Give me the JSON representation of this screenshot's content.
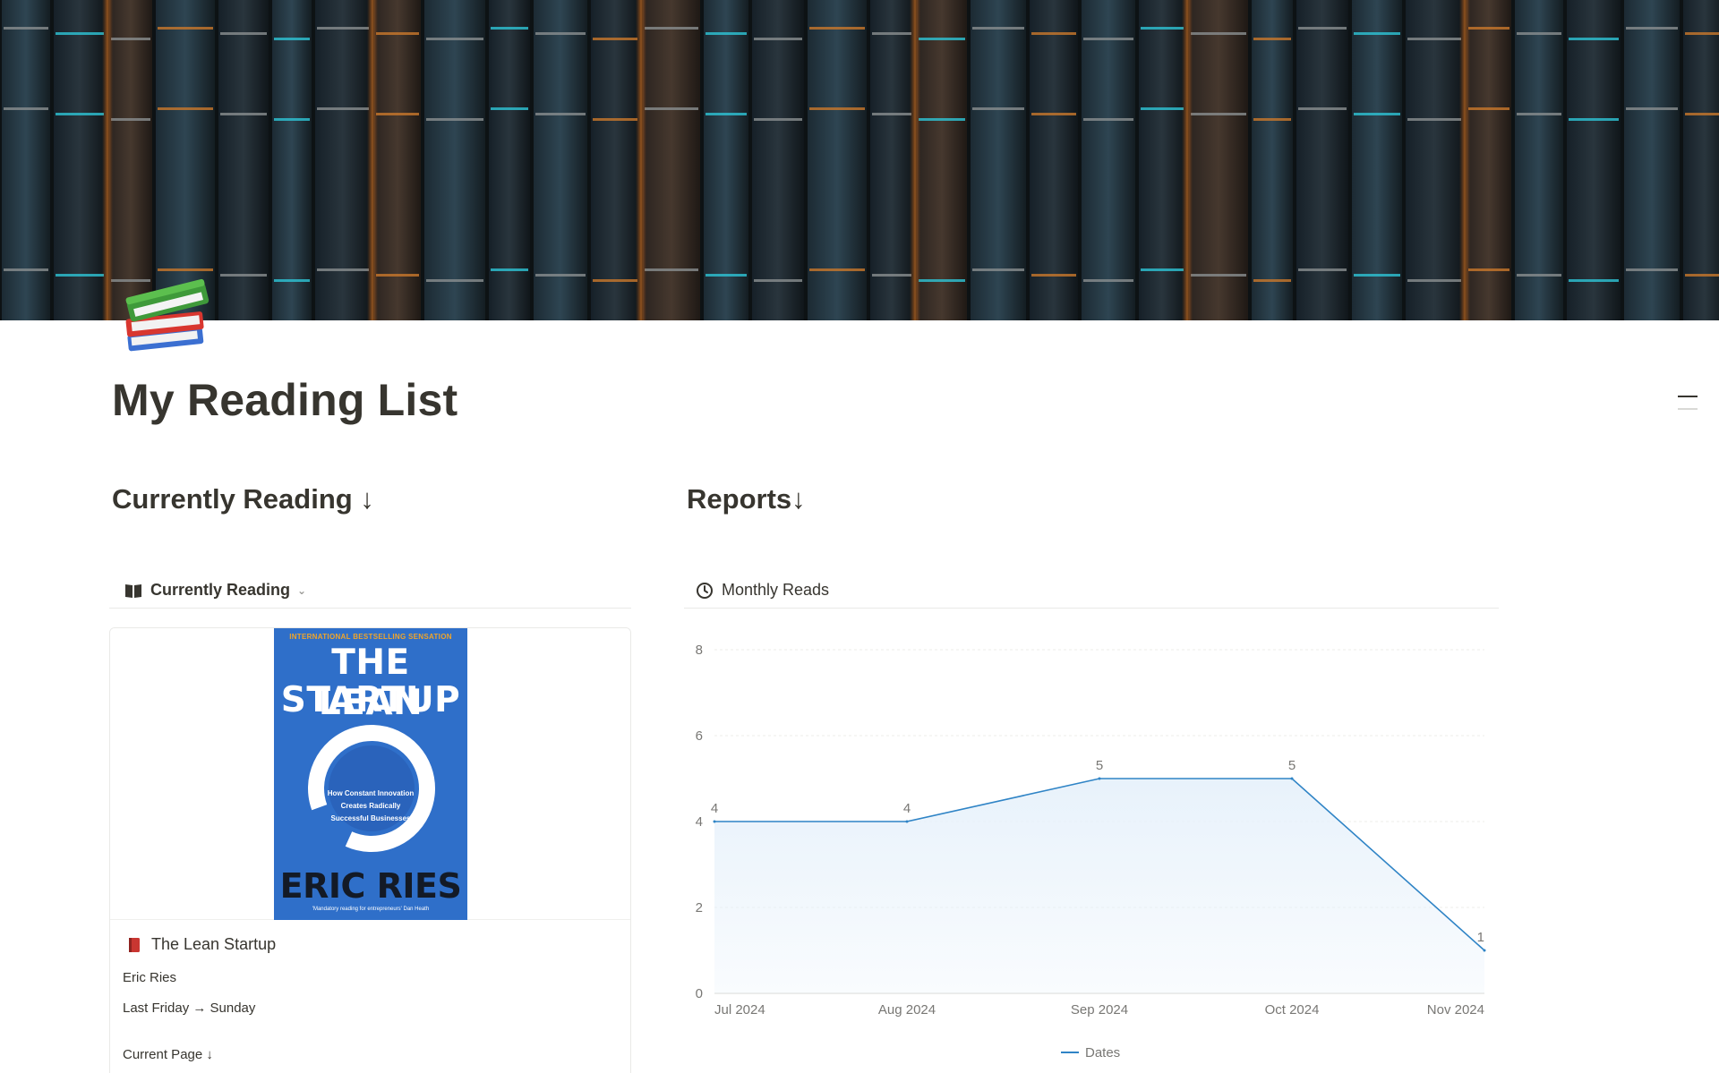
{
  "page": {
    "title": "My Reading List"
  },
  "sections": {
    "currently_reading": "Currently Reading ↓",
    "reports": "Reports↓"
  },
  "views": {
    "currently_reading": {
      "label": "Currently Reading",
      "icon": "open-book-icon"
    },
    "reports": {
      "label": "Monthly Reads",
      "icon": "clock-icon"
    }
  },
  "card": {
    "title": "The Lean Startup",
    "icon": "red-book-icon",
    "author": "Eric Ries",
    "dates": "Last Friday → Sunday",
    "current_page_label": "Current Page ↓",
    "cover": {
      "tagline": "INTERNATIONAL BESTSELLING SENSATION",
      "title_line1": "THE LEAN",
      "title_line2": "STARTUP",
      "blurb_line1": "How Constant Innovation",
      "blurb_line2": "Creates Radically",
      "blurb_line3": "Successful Businesses",
      "author": "ERIC RIES",
      "quote": "'Mandatory reading for entrepreneurs' Dan Heath"
    }
  },
  "chart_data": {
    "type": "area",
    "x": [
      "Jul 2024",
      "Aug 2024",
      "Sep 2024",
      "Oct 2024",
      "Nov 2024"
    ],
    "series": [
      {
        "name": "Dates",
        "values": [
          4,
          4,
          5,
          5,
          1
        ]
      }
    ],
    "ylim": [
      0,
      8
    ],
    "yticks": [
      0,
      2,
      4,
      6,
      8
    ],
    "grid": true,
    "legend": "bottom",
    "data_labels": true,
    "line_color": "#2f84c6",
    "fill_color": "#e8f2fb"
  }
}
